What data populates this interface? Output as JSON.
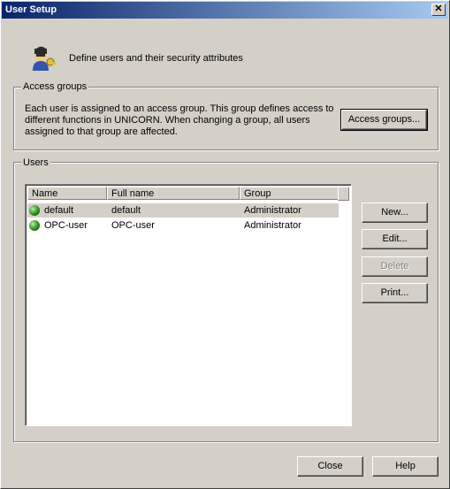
{
  "window": {
    "title": "User Setup",
    "close_glyph": "✕"
  },
  "header": {
    "description": "Define users and their security attributes",
    "icon": "user-key-icon"
  },
  "access_groups": {
    "label": "Access groups",
    "text_line1": "Each user is assigned to an access group. This group defines access to",
    "text_line2": "different functions in UNICORN. When changing a group, all users",
    "text_line3": "assigned to that group are affected.",
    "button": "Access groups..."
  },
  "users": {
    "label": "Users",
    "columns": [
      "Name",
      "Full name",
      "Group"
    ],
    "rows": [
      {
        "name": "default",
        "full_name": "default",
        "group": "Administrator"
      },
      {
        "name": "OPC-user",
        "full_name": "OPC-user",
        "group": "Administrator"
      }
    ],
    "buttons": {
      "new": "New...",
      "edit": "Edit...",
      "delete": "Delete",
      "print": "Print..."
    }
  },
  "footer": {
    "close": "Close",
    "help": "Help"
  },
  "colors": {
    "title_start": "#0a246a",
    "title_end": "#a6caf0",
    "status_dot": "#2e8a1e"
  }
}
